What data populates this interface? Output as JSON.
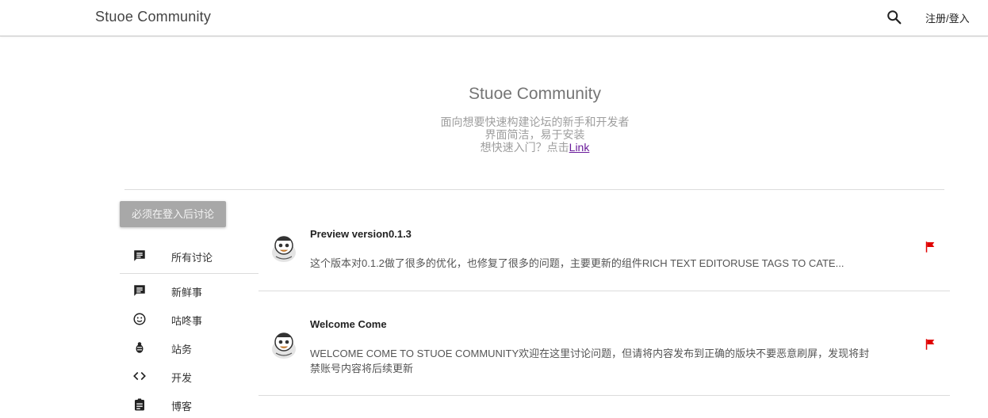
{
  "header": {
    "brand": "Stuoe Community",
    "search_icon": "search-icon",
    "login_label": "注册/登入"
  },
  "hero": {
    "title": "Stuoe Community",
    "line1": "面向想要快速构建论坛的新手和开发者",
    "line2": "界面简洁，易于安装",
    "line3_text": "想快速入门？点击",
    "line3_link": "Link"
  },
  "sidebar": {
    "must_login_label": "必须在登入后讨论",
    "items": [
      {
        "label": "所有讨论",
        "icon": "chat-icon"
      },
      {
        "label": "新鲜事",
        "icon": "chat-icon"
      },
      {
        "label": "咕咚事",
        "icon": "emoji-icon"
      },
      {
        "label": "站务",
        "icon": "bug-icon"
      },
      {
        "label": "开发",
        "icon": "code-icon"
      },
      {
        "label": "博客",
        "icon": "clipboard-icon"
      }
    ]
  },
  "posts": [
    {
      "title": "Preview version0.1.3",
      "excerpt": "这个版本对0.1.2做了很多的优化，也修复了很多的问题，主要更新的组件RICH TEXT EDITORUSE TAGS TO CATE...",
      "flag_color": "#e00000"
    },
    {
      "title": "Welcome Come",
      "excerpt_line1": "WELCOME COME TO STUOE COMMUNITY欢迎在这里讨论问题，但请将内容发布到正确的版块不要恶意刷屏，发现将封",
      "excerpt_line2": "禁账号内容将后续更新",
      "flag_color": "#e00000"
    }
  ],
  "colors": {
    "accent_flag": "#e00000",
    "link": "#6a1b9a",
    "button_disabled": "#a8a8a8"
  }
}
